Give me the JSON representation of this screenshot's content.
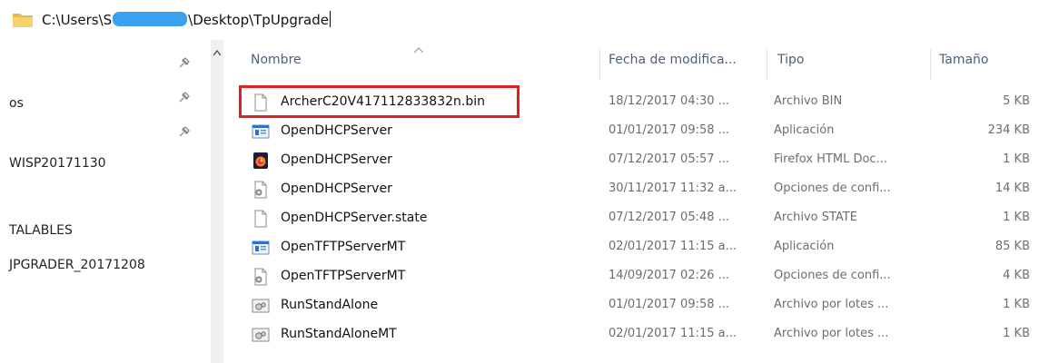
{
  "address_bar": {
    "path_start": "C:\\Users\\S",
    "path_end": "\\Desktop\\TpUpgrade"
  },
  "nav": {
    "items": [
      {
        "label": "os"
      },
      {
        "label": "WISP20171130"
      },
      {
        "label": "TALABLES"
      },
      {
        "label": "JPGRADER_20171208"
      }
    ]
  },
  "columns": {
    "name": "Nombre",
    "date": "Fecha de modifica...",
    "type": "Tipo",
    "size": "Tamaño"
  },
  "files": [
    {
      "name": "ArcherC20V417112833832n.bin",
      "date": "18/12/2017 04:30 ...",
      "type": "Archivo BIN",
      "size": "5 KB",
      "icon": "blank-file-icon"
    },
    {
      "name": "OpenDHCPServer",
      "date": "01/01/2017 09:58 ...",
      "type": "Aplicación",
      "size": "234 KB",
      "icon": "application-icon"
    },
    {
      "name": "OpenDHCPServer",
      "date": "07/12/2017 05:57 ...",
      "type": "Firefox HTML Doc...",
      "size": "1 KB",
      "icon": "firefox-html-icon"
    },
    {
      "name": "OpenDHCPServer",
      "date": "30/11/2017 11:32 a...",
      "type": "Opciones de confi...",
      "size": "14 KB",
      "icon": "config-file-icon"
    },
    {
      "name": "OpenDHCPServer.state",
      "date": "07/12/2017 05:48 ...",
      "type": "Archivo STATE",
      "size": "1 KB",
      "icon": "blank-file-icon"
    },
    {
      "name": "OpenTFTPServerMT",
      "date": "02/01/2017 11:15 a...",
      "type": "Aplicación",
      "size": "85 KB",
      "icon": "application-icon"
    },
    {
      "name": "OpenTFTPServerMT",
      "date": "14/09/2017 02:26 ...",
      "type": "Opciones de confi...",
      "size": "4 KB",
      "icon": "config-file-icon"
    },
    {
      "name": "RunStandAlone",
      "date": "01/01/2017 09:58 ...",
      "type": "Archivo por lotes ...",
      "size": "1 KB",
      "icon": "batch-file-icon"
    },
    {
      "name": "RunStandAloneMT",
      "date": "02/01/2017 11:15 a...",
      "type": "Archivo por lotes ...",
      "size": "1 KB",
      "icon": "batch-file-icon"
    }
  ],
  "colors": {
    "highlight": "#e02020",
    "redaction": "#3aa0f0",
    "header_text": "#4c607a"
  }
}
